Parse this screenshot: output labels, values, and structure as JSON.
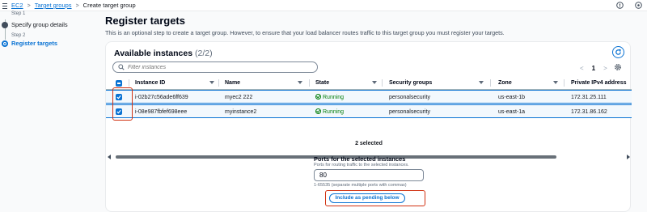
{
  "breadcrumbs": [
    {
      "label": "EC2",
      "link": true
    },
    {
      "label": "Target groups",
      "link": true
    },
    {
      "label": "Create target group",
      "link": false
    }
  ],
  "breadcrumb_separator": ">",
  "steps": [
    {
      "small": "Step 1",
      "name": "Specify group details",
      "active": false
    },
    {
      "small": "Step 2",
      "name": "Register targets",
      "active": true
    }
  ],
  "page": {
    "title": "Register targets",
    "description": "This is an optional step to create a target group. However, to ensure that your load balancer routes traffic to this target group you must register your targets."
  },
  "instances": {
    "title": "Available instances",
    "count": "(2/2)",
    "filter_placeholder": "Filter instances",
    "page_number": "1",
    "prev_arrow": "<",
    "next_arrow": ">",
    "columns": [
      "Instance ID",
      "Name",
      "State",
      "Security groups",
      "Zone",
      "Private IPv4 address"
    ],
    "rows": [
      {
        "id": "i-02b27c56ade6ff639",
        "name": "myec2 222",
        "state": "Running",
        "sg": "personalsecurity",
        "zone": "us-east-1b",
        "ip": "172.31.25.111"
      },
      {
        "id": "i-08e987fbfef698eee",
        "name": "myinstance2",
        "state": "Running",
        "sg": "personalsecurity",
        "zone": "us-east-1a",
        "ip": "172.31.86.162"
      }
    ]
  },
  "selection": {
    "selected_text": "2 selected",
    "ports_title": "Ports for the selected instances",
    "ports_desc": "Ports for routing traffic to the selected instances.",
    "port_value": "80",
    "port_hint": "1-65535 (separate multiple ports with commas)",
    "include_button": "Include as pending below"
  },
  "colors": {
    "accent": "#0972d3",
    "success": "#037f0c",
    "highlight": "#d13212"
  }
}
